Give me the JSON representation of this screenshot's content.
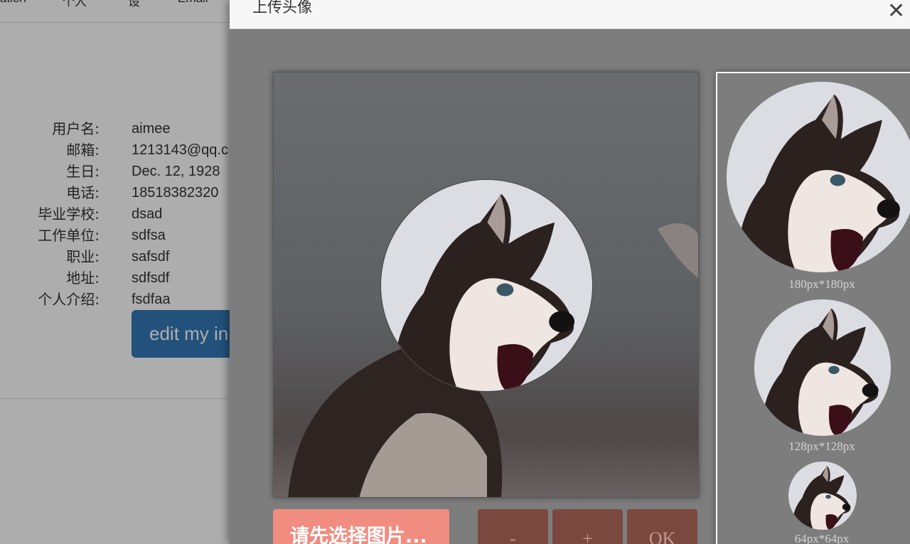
{
  "nav": {
    "items": [
      "ation",
      "个人",
      "设",
      "Email"
    ]
  },
  "profile": {
    "rows": [
      {
        "label": "用户名:",
        "value": "aimee"
      },
      {
        "label": "邮箱:",
        "value": "1213143@qq.c"
      },
      {
        "label": "生日:",
        "value": "Dec. 12, 1928"
      },
      {
        "label": "电话:",
        "value": "18518382320"
      },
      {
        "label": "毕业学校:",
        "value": "dsad"
      },
      {
        "label": "工作单位:",
        "value": "sdfsa"
      },
      {
        "label": "职业:",
        "value": "safsdf"
      },
      {
        "label": "地址:",
        "value": "sdfsdf"
      },
      {
        "label": "个人介绍:",
        "value": "fsdfaa"
      }
    ],
    "edit_button": "edit my in"
  },
  "modal": {
    "title": "上传头像",
    "close": "✕",
    "previews": [
      {
        "label": "180px*180px"
      },
      {
        "label": "128px*128px"
      },
      {
        "label": "64px*64px"
      }
    ],
    "choose_button": "请先选择图片...",
    "tool_buttons": [
      "-",
      "+",
      "OK"
    ]
  }
}
